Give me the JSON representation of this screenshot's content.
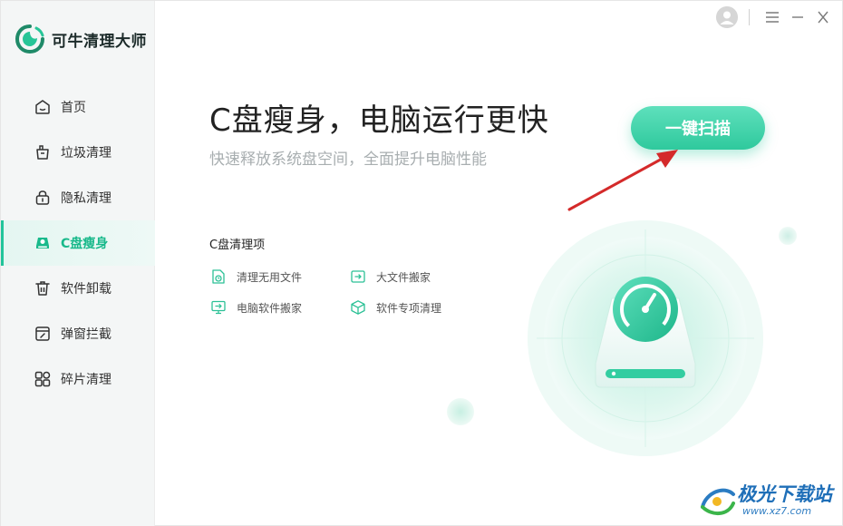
{
  "app": {
    "name": "可牛清理大师"
  },
  "sidebar": {
    "items": [
      {
        "label": "首页",
        "icon": "home-icon",
        "active": false
      },
      {
        "label": "垃圾清理",
        "icon": "trash-bag-icon",
        "active": false
      },
      {
        "label": "隐私清理",
        "icon": "lock-icon",
        "active": false
      },
      {
        "label": "C盘瘦身",
        "icon": "disk-icon",
        "active": true
      },
      {
        "label": "软件卸载",
        "icon": "uninstall-icon",
        "active": false
      },
      {
        "label": "弹窗拦截",
        "icon": "popup-block-icon",
        "active": false
      },
      {
        "label": "碎片清理",
        "icon": "grid-icon",
        "active": false
      }
    ]
  },
  "window_controls": {
    "avatar": "user-avatar-icon",
    "menu": "menu-icon",
    "minimize": "minimize-icon",
    "close": "close-icon"
  },
  "main": {
    "headline": "C盘瘦身，电脑运行更快",
    "subline": "快速释放系统盘空间，全面提升电脑性能",
    "scan_button": "一键扫描",
    "items_title": "C盘清理项",
    "items": [
      {
        "label": "清理无用文件",
        "icon": "file-clean-icon"
      },
      {
        "label": "大文件搬家",
        "icon": "file-move-icon"
      },
      {
        "label": "电脑软件搬家",
        "icon": "software-move-icon"
      },
      {
        "label": "软件专项清理",
        "icon": "package-icon"
      }
    ]
  },
  "watermark": {
    "text": "极光下载站",
    "url": "www.xz7.com"
  },
  "colors": {
    "accent": "#21c49a",
    "annotation_arrow": "#d42a2a",
    "watermark": "#1f6fb8"
  }
}
